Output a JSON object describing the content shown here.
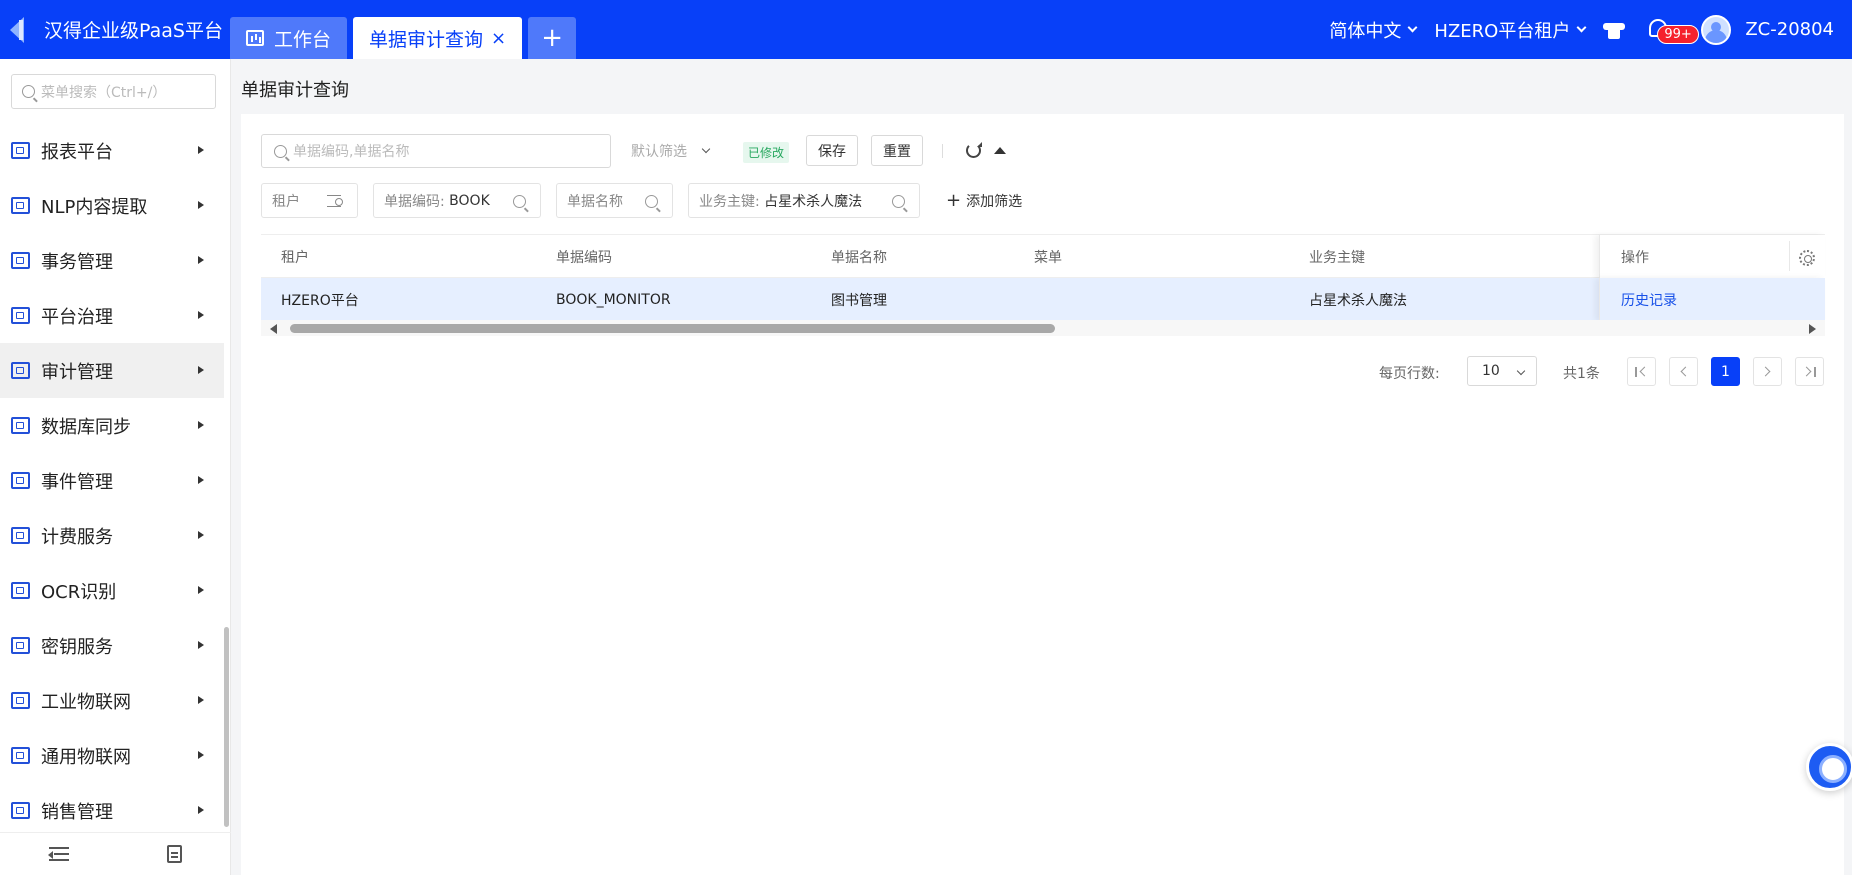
{
  "header": {
    "logo_text": "汉得企业级PaaS平台",
    "tabs": [
      {
        "label": "工作台"
      },
      {
        "label": "单据审计查询",
        "close": "×"
      }
    ],
    "add_tab": "+",
    "language": "简体中文",
    "tenant": "HZERO平台租户",
    "notification_count": "99+",
    "username": "ZC-20804"
  },
  "sidebar": {
    "search_placeholder": "菜单搜索（Ctrl+/）",
    "items": [
      {
        "label": "报表平台"
      },
      {
        "label": "NLP内容提取"
      },
      {
        "label": "事务管理"
      },
      {
        "label": "平台治理"
      },
      {
        "label": "审计管理"
      },
      {
        "label": "数据库同步"
      },
      {
        "label": "事件管理"
      },
      {
        "label": "计费服务"
      },
      {
        "label": "OCR识别"
      },
      {
        "label": "密钥服务"
      },
      {
        "label": "工业物联网"
      },
      {
        "label": "通用物联网"
      },
      {
        "label": "销售管理"
      }
    ]
  },
  "page": {
    "title": "单据审计查询"
  },
  "toolbar": {
    "search_placeholder": "单据编码,单据名称",
    "default_filter": "默认筛选",
    "modified_tag": "已修改",
    "save": "保存",
    "reset": "重置"
  },
  "filters": {
    "tenant": "租户",
    "code_label": "单据编码:",
    "code_value": "BOOK",
    "name": "单据名称",
    "key_label": "业务主键:",
    "key_value": "占星术杀人魔法",
    "add_filter": "添加筛选"
  },
  "table": {
    "columns": [
      "租户",
      "单据编码",
      "单据名称",
      "菜单",
      "业务主键",
      "操作"
    ],
    "rows": [
      {
        "tenant": "HZERO平台",
        "code": "BOOK_MONITOR",
        "name": "图书管理",
        "menu": "",
        "key": "占星术杀人魔法",
        "action": "历史记录"
      }
    ]
  },
  "pagination": {
    "page_size_label": "每页行数:",
    "page_size": "10",
    "total": "共1条",
    "current_page": "1"
  },
  "colors": {
    "brand": "#0840f8",
    "selected_row": "#e6efff",
    "link": "#1750e8"
  }
}
